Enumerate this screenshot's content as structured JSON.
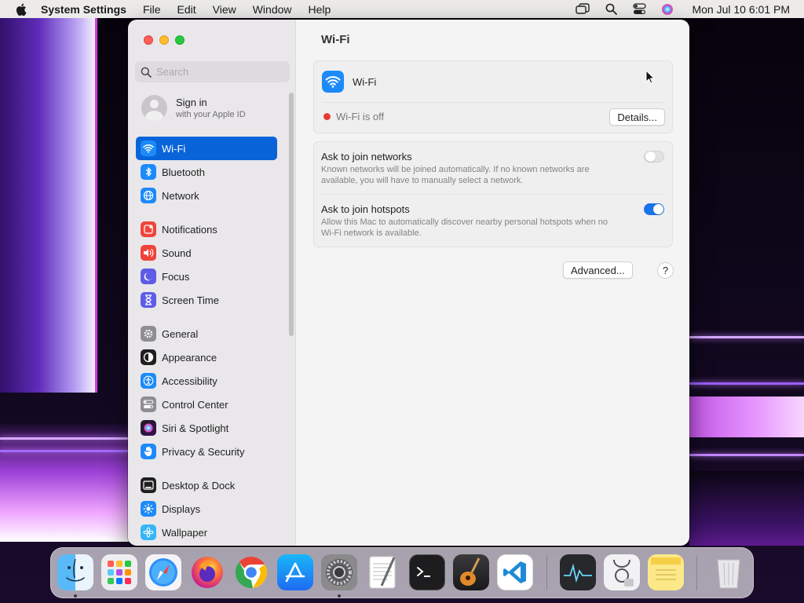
{
  "menubar": {
    "app_name": "System Settings",
    "menus": [
      "File",
      "Edit",
      "View",
      "Window",
      "Help"
    ],
    "clock": "Mon Jul 10  6:01 PM",
    "status_icons": [
      "screen-mirroring-icon",
      "spotlight-search-icon",
      "control-center-icon",
      "siri-icon"
    ]
  },
  "sidebar": {
    "search_placeholder": "Search",
    "account": {
      "name": "Sign in",
      "subtitle": "with your Apple ID"
    },
    "items": [
      {
        "label": "Wi-Fi",
        "icon": "wifi-icon",
        "color": "#1d8af9",
        "active": true
      },
      {
        "label": "Bluetooth",
        "icon": "bluetooth-icon",
        "color": "#1d8af9"
      },
      {
        "label": "Network",
        "icon": "globe-icon",
        "color": "#1d8af9"
      },
      {
        "label": "Notifications",
        "icon": "bell-icon",
        "color": "#f0443a"
      },
      {
        "label": "Sound",
        "icon": "speaker-icon",
        "color": "#f0443a"
      },
      {
        "label": "Focus",
        "icon": "moon-icon",
        "color": "#5e5ce6"
      },
      {
        "label": "Screen Time",
        "icon": "hourglass-icon",
        "color": "#5e5ce6"
      },
      {
        "label": "General",
        "icon": "gear-icon",
        "color": "#8e8d91"
      },
      {
        "label": "Appearance",
        "icon": "appearance-icon",
        "color": "#1f1f1f"
      },
      {
        "label": "Accessibility",
        "icon": "accessibility-icon",
        "color": "#1d8af9"
      },
      {
        "label": "Control Center",
        "icon": "control-center-icon",
        "color": "#8e8d91"
      },
      {
        "label": "Siri & Spotlight",
        "icon": "siri-icon",
        "color": "#b23fd0"
      },
      {
        "label": "Privacy & Security",
        "icon": "hand-icon",
        "color": "#1d8af9"
      },
      {
        "label": "Desktop & Dock",
        "icon": "desktop-dock-icon",
        "color": "#1f1f1f"
      },
      {
        "label": "Displays",
        "icon": "sun-icon",
        "color": "#1d8af9"
      },
      {
        "label": "Wallpaper",
        "icon": "wallpaper-icon",
        "color": "#35b6f5"
      }
    ]
  },
  "content": {
    "title": "Wi-Fi",
    "wifi_label": "Wi-Fi",
    "wifi_enabled": false,
    "status_text": "Wi-Fi is off",
    "details_button": "Details...",
    "ask_networks": {
      "title": "Ask to join networks",
      "description": "Known networks will be joined automatically. If no known networks are available, you will have to manually select a network.",
      "enabled": false
    },
    "ask_hotspots": {
      "title": "Ask to join hotspots",
      "description": "Allow this Mac to automatically discover nearby personal hotspots when no Wi-Fi network is available.",
      "enabled": true
    },
    "advanced_button": "Advanced...",
    "help_button": "?"
  },
  "dock": {
    "apps": [
      {
        "name": "finder",
        "running": true
      },
      {
        "name": "launchpad",
        "running": false
      },
      {
        "name": "safari",
        "running": false
      },
      {
        "name": "firefox",
        "running": false
      },
      {
        "name": "chrome",
        "running": false
      },
      {
        "name": "app-store",
        "running": false
      },
      {
        "name": "system-settings",
        "running": true
      },
      {
        "name": "textedit",
        "running": false
      },
      {
        "name": "terminal",
        "running": false
      },
      {
        "name": "garageband",
        "running": false
      },
      {
        "name": "vscode",
        "running": false
      },
      {
        "name": "activity-monitor",
        "running": false
      },
      {
        "name": "disk-utility",
        "running": false
      },
      {
        "name": "notes",
        "running": false
      },
      {
        "name": "trash",
        "running": false
      }
    ]
  }
}
